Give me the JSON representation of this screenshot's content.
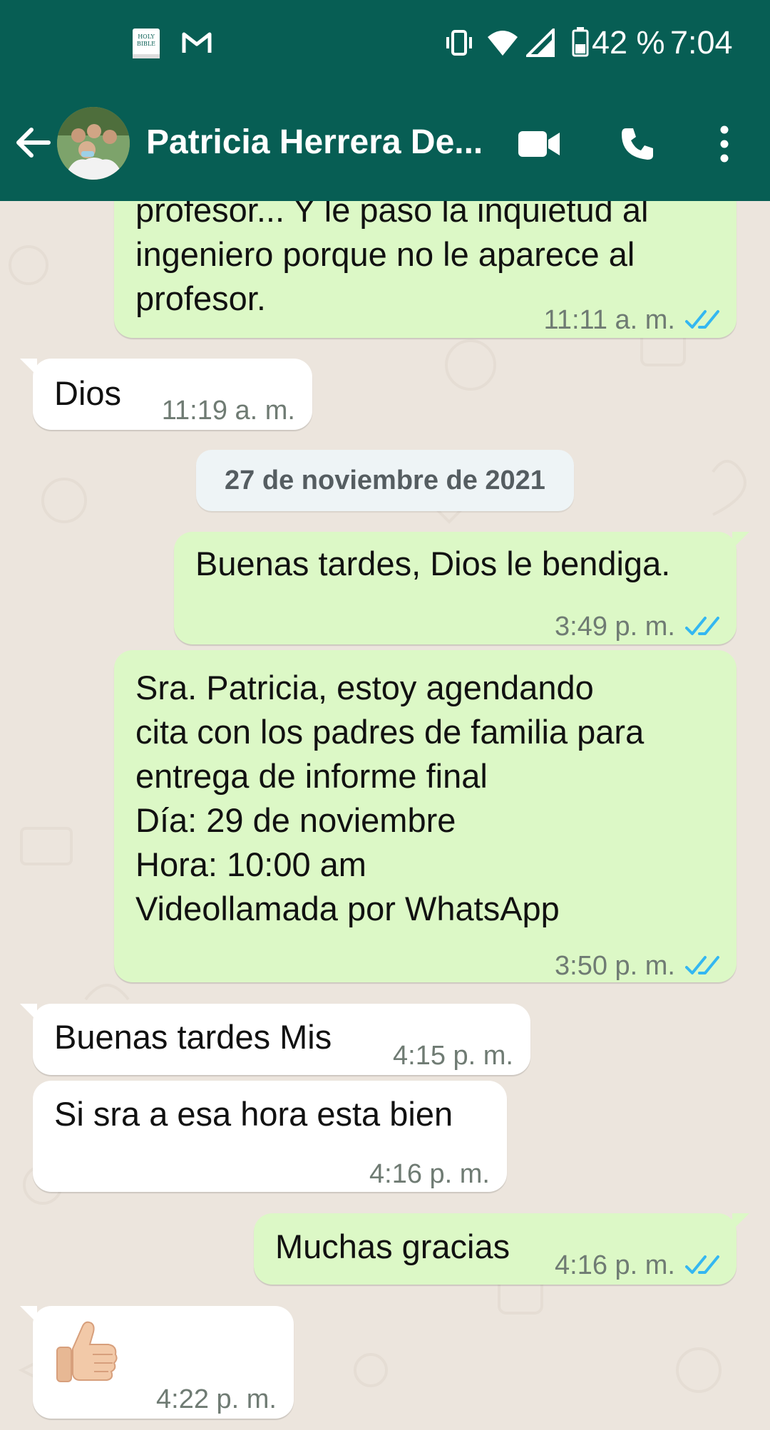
{
  "status_bar": {
    "battery": "42 %",
    "time": "7:04",
    "app_icon_label_1": "HOLY",
    "app_icon_label_2": "BIBLE"
  },
  "header": {
    "contact_name": "Patricia Herrera De..."
  },
  "chat": {
    "messages": [
      {
        "direction": "out",
        "text": "profesor... Y le paso la inquietud al\ningeniero porque no le  aparece al\nprofesor.",
        "time": "11:11 a. m.",
        "read": true
      },
      {
        "direction": "in",
        "text": "Dios",
        "time": "11:19 a. m."
      },
      {
        "direction": "out",
        "text": "Buenas tardes, Dios le bendiga.",
        "time": "3:49 p. m.",
        "read": true
      },
      {
        "direction": "out",
        "text": "Sra. Patricia, estoy agendando\ncita con los padres de familia para\nentrega de informe final\nDía: 29 de noviembre\nHora: 10:00 am\nVideollamada por WhatsApp",
        "time": "3:50 p. m.",
        "read": true
      },
      {
        "direction": "in",
        "text": "Buenas tardes Mis",
        "time": "4:15 p. m."
      },
      {
        "direction": "in",
        "text": "Si sra a esa hora esta bien",
        "time": "4:16 p. m."
      },
      {
        "direction": "out",
        "text": "Muchas gracias",
        "time": "4:16 p. m.",
        "read": true
      },
      {
        "direction": "in",
        "text": "👍🏻",
        "time": "4:22 p. m."
      }
    ],
    "date_separator": "27 de noviembre de 2021"
  },
  "colors": {
    "header": "#075e54",
    "outgoing": "#dcf8c6",
    "incoming": "#ffffff",
    "background": "#ece5dd",
    "read_tick": "#34b7f1"
  }
}
